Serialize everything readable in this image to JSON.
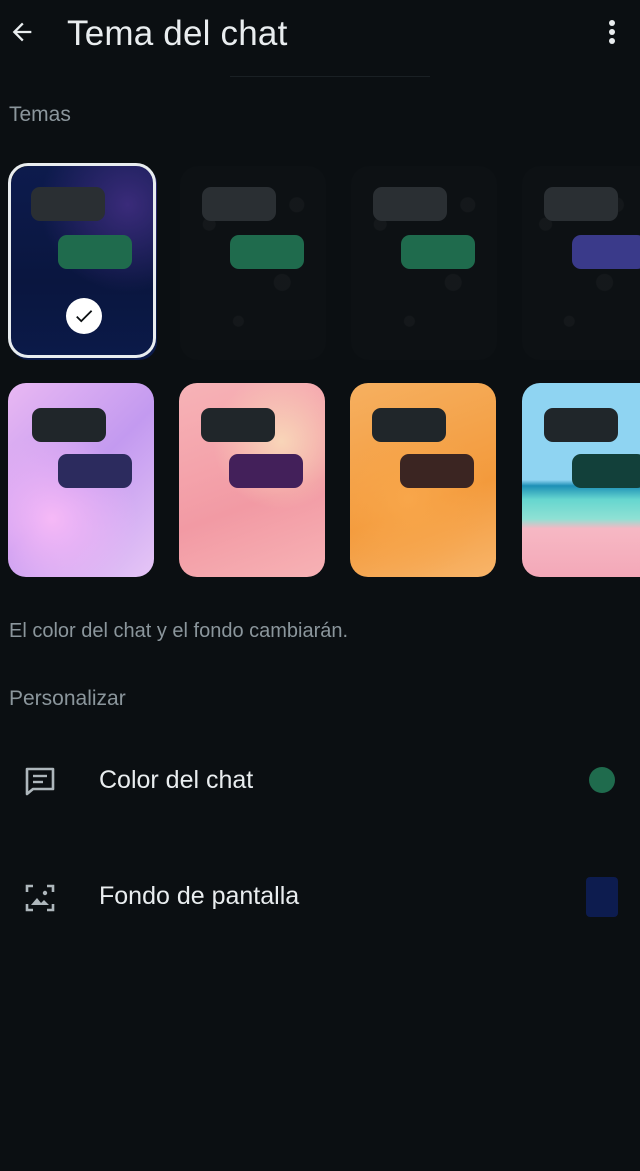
{
  "header": {
    "title": "Tema del chat",
    "back_icon": "arrow-left-icon",
    "menu_icon": "more-vertical-icon"
  },
  "sections": {
    "themes_label": "Temas",
    "customize_label": "Personalizar"
  },
  "themes": [
    {
      "name": "theme-space",
      "selected": true,
      "incoming_color": "#2a2f33",
      "outgoing_color": "#1f6b4d"
    },
    {
      "name": "theme-dark-1",
      "selected": false,
      "incoming_color": "#2a2f33",
      "outgoing_color": "#1f6b4d"
    },
    {
      "name": "theme-dark-2",
      "selected": false,
      "incoming_color": "#2a2f33",
      "outgoing_color": "#1f6b4d"
    },
    {
      "name": "theme-dark-3",
      "selected": false,
      "incoming_color": "#2a2f33",
      "outgoing_color": "#3a3a8a"
    },
    {
      "name": "theme-purple",
      "selected": false,
      "incoming_color": "#20262a",
      "outgoing_color": "#2c2b5e"
    },
    {
      "name": "theme-pink",
      "selected": false,
      "incoming_color": "#20262a",
      "outgoing_color": "#43205a"
    },
    {
      "name": "theme-orange",
      "selected": false,
      "incoming_color": "#20262a",
      "outgoing_color": "#3b2522"
    },
    {
      "name": "theme-beach",
      "selected": false,
      "incoming_color": "#20262a",
      "outgoing_color": "#12403a"
    }
  ],
  "footnote": "El color del chat y el fondo cambiarán.",
  "options": {
    "chat_color": {
      "label": "Color del chat",
      "icon": "chat-bubble-icon",
      "value_color": "#1f6b4d"
    },
    "wallpaper": {
      "label": "Fondo de pantalla",
      "icon": "wallpaper-icon",
      "value_color": "#0d1c4f"
    }
  }
}
